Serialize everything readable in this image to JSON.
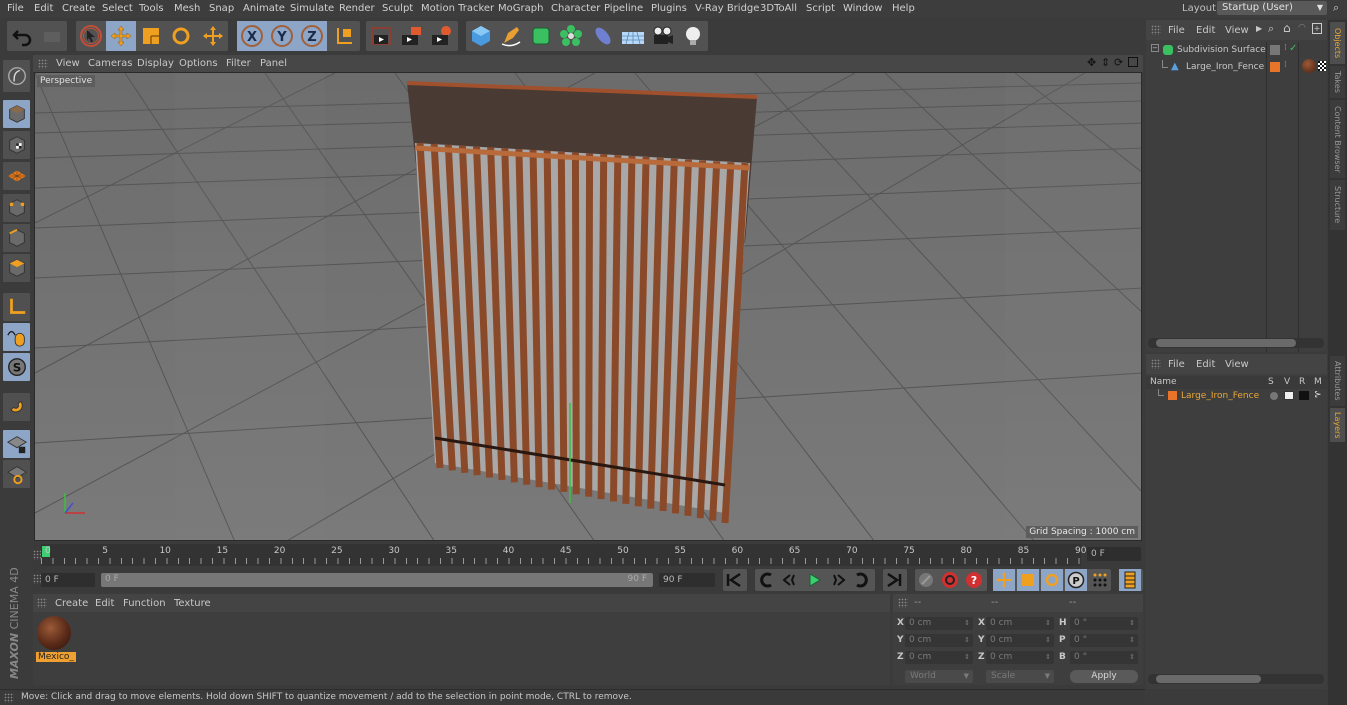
{
  "menubar": {
    "items": [
      "File",
      "Edit",
      "Create",
      "Select",
      "Tools",
      "Mesh",
      "Snap",
      "Animate",
      "Simulate",
      "Render",
      "Sculpt",
      "Motion Tracker",
      "MoGraph",
      "Character",
      "Pipeline",
      "Plugins",
      "V-Ray Bridge",
      "3DToAll",
      "Script",
      "Window",
      "Help"
    ],
    "layout_label": "Layout:",
    "layout_value": "Startup (User)"
  },
  "toolbar": {
    "undo": "undo-icon",
    "redo": "redo-icon",
    "tools": [
      "live-selection",
      "move",
      "scale",
      "rotate",
      "recent-tool"
    ],
    "axes": [
      "X",
      "Y",
      "Z"
    ],
    "coord_system": "world-coordinate-icon",
    "render": [
      "render-view",
      "render-picture-viewer",
      "render-settings"
    ],
    "objects": [
      "cube",
      "pen-spline",
      "subdivision-surface",
      "cloner",
      "deformer",
      "floor",
      "camera",
      "light"
    ]
  },
  "left_tools": [
    "make-editable",
    "model-mode",
    "texture-mode",
    "points-mode",
    "edges-mode",
    "polygons-mode",
    "axis-mode",
    "tweak-mode",
    "solo-mode",
    "snapping",
    "workplane-lock",
    "workplane"
  ],
  "viewport": {
    "menu": [
      "View",
      "Cameras",
      "Display",
      "Options",
      "Filter",
      "Panel"
    ],
    "camera_label": "Perspective",
    "grid_spacing": "Grid Spacing : 1000 cm",
    "nav_icons": [
      "move-view-icon",
      "dolly-icon",
      "rotate-view-icon",
      "maximize-icon"
    ]
  },
  "timeline": {
    "ticks": [
      "0",
      "5",
      "10",
      "15",
      "20",
      "25",
      "30",
      "35",
      "40",
      "45",
      "50",
      "55",
      "60",
      "65",
      "70",
      "75",
      "80",
      "85",
      "90"
    ],
    "current_frame": "0 F",
    "start_frame": "0 F",
    "range_start": "0 F",
    "range_end": "90 F",
    "end_frame": "90 F"
  },
  "material_panel": {
    "menu": [
      "Create",
      "Edit",
      "Function",
      "Texture"
    ],
    "materials": [
      {
        "name": "Mexico_"
      }
    ]
  },
  "coordinates": {
    "headers": [
      "--",
      "--",
      "--"
    ],
    "rows": [
      {
        "l1": "X",
        "v1": "0 cm",
        "l2": "X",
        "v2": "0 cm",
        "l3": "H",
        "v3": "0 °"
      },
      {
        "l1": "Y",
        "v1": "0 cm",
        "l2": "Y",
        "v2": "0 cm",
        "l3": "P",
        "v3": "0 °"
      },
      {
        "l1": "Z",
        "v1": "0 cm",
        "l2": "Z",
        "v2": "0 cm",
        "l3": "B",
        "v3": "0 °"
      }
    ],
    "mode": "World",
    "size_mode": "Scale",
    "apply": "Apply"
  },
  "status": "Move: Click and drag to move elements. Hold down SHIFT to quantize movement / add to the selection in point mode, CTRL to remove.",
  "brand": {
    "maxon": "MAXON",
    "product": "CINEMA 4D"
  },
  "objects_panel": {
    "menu": [
      "File",
      "Edit",
      "View"
    ],
    "objects": [
      {
        "name": "Subdivision Surface"
      },
      {
        "name": "Large_Iron_Fence"
      }
    ]
  },
  "layers_panel": {
    "menu": [
      "File",
      "Edit",
      "View"
    ],
    "columns": [
      "Name",
      "S",
      "V",
      "R",
      "M"
    ],
    "layers": [
      {
        "name": "Large_Iron_Fence",
        "color": "#e8742a"
      }
    ]
  },
  "right_tabs": {
    "top": [
      "Objects",
      "Takes",
      "Content Browser",
      "Structure"
    ],
    "bottom": [
      "Attributes",
      "Layers"
    ]
  },
  "colors": {
    "accent": "#e8a838",
    "selected_tool": "#8da6c8",
    "layer_color": "#e8742a"
  }
}
